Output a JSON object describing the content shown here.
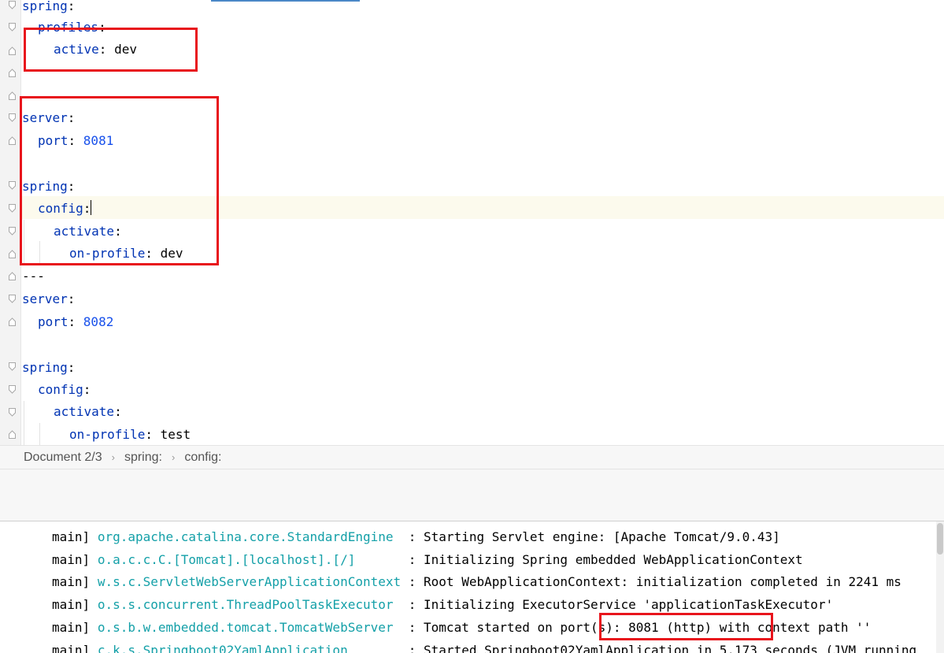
{
  "editor": {
    "lines": [
      {
        "key": "spring",
        "sep": ":",
        "value": ""
      },
      {
        "key": "profiles",
        "sep": ":",
        "value": ""
      },
      {
        "key": "active",
        "sep": ": ",
        "value": "dev"
      },
      {
        "key": "server",
        "sep": ":",
        "value": ""
      },
      {
        "key": "port",
        "sep": ": ",
        "value": "8081"
      },
      {
        "key": "spring",
        "sep": ":",
        "value": ""
      },
      {
        "key": "config",
        "sep": ":",
        "value": ""
      },
      {
        "key": "activate",
        "sep": ":",
        "value": ""
      },
      {
        "key": "on-profile",
        "sep": ": ",
        "value": "dev"
      },
      {
        "key": "",
        "sep": "",
        "value": "---"
      },
      {
        "key": "server",
        "sep": ":",
        "value": ""
      },
      {
        "key": "port",
        "sep": ": ",
        "value": "8082"
      },
      {
        "key": "spring",
        "sep": ":",
        "value": ""
      },
      {
        "key": "config",
        "sep": ":",
        "value": ""
      },
      {
        "key": "activate",
        "sep": ":",
        "value": ""
      },
      {
        "key": "on-profile",
        "sep": ": ",
        "value": "test"
      }
    ]
  },
  "breadcrumb": {
    "document": "Document 2/3",
    "items": [
      "spring:",
      "config:"
    ]
  },
  "console": {
    "lines": [
      {
        "thread": "main]",
        "logger": "org.apache.catalina.core.StandardEngine  ",
        "message": ": Starting Servlet engine: [Apache Tomcat/9.0.43]"
      },
      {
        "thread": "main]",
        "logger": "o.a.c.c.C.[Tomcat].[localhost].[/]       ",
        "message": ": Initializing Spring embedded WebApplicationContext"
      },
      {
        "thread": "main]",
        "logger": "w.s.c.ServletWebServerApplicationContext ",
        "message": ": Root WebApplicationContext: initialization completed in 2241 ms"
      },
      {
        "thread": "main]",
        "logger": "o.s.s.concurrent.ThreadPoolTaskExecutor  ",
        "message": ": Initializing ExecutorService 'applicationTaskExecutor'"
      },
      {
        "thread": "main]",
        "logger": "o.s.b.w.embedded.tomcat.TomcatWebServer  ",
        "message": ": Tomcat started on port(s): 8081 (http) with context path ''"
      },
      {
        "thread": "main]",
        "logger": "c.k.s.Springboot02YamlApplication        ",
        "message": ": Started Springboot02YamlApplication in 5.173 seconds (JVM running"
      }
    ]
  },
  "colors": {
    "yaml_key": "#0033b3",
    "yaml_number": "#1750eb",
    "logger": "#14a0a8",
    "annotation_box": "#e8141c",
    "current_line": "#fcfaed"
  },
  "icons": [
    "fold-open-icon",
    "fold-close-icon"
  ]
}
